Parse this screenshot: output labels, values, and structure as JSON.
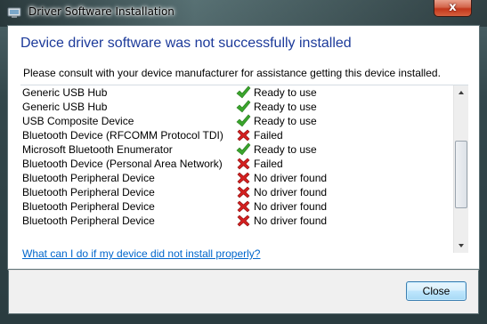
{
  "window": {
    "title": "Driver Software Installation",
    "close_glyph": "x",
    "icon": "usb-device-icon"
  },
  "main": {
    "heading": "Device driver software was not successfully installed",
    "subtext": "Please consult with your device manufacturer for assistance getting this device installed."
  },
  "devices": [
    {
      "name": "Generic USB Hub",
      "status": "Ready to use",
      "icon": "check-icon"
    },
    {
      "name": "Generic USB Hub",
      "status": "Ready to use",
      "icon": "check-icon"
    },
    {
      "name": "USB Composite Device",
      "status": "Ready to use",
      "icon": "check-icon"
    },
    {
      "name": "Bluetooth Device (RFCOMM Protocol TDI)",
      "status": "Failed",
      "icon": "error-x-icon"
    },
    {
      "name": "Microsoft Bluetooth Enumerator",
      "status": "Ready to use",
      "icon": "check-icon"
    },
    {
      "name": "Bluetooth Device (Personal Area Network)",
      "status": "Failed",
      "icon": "error-x-icon"
    },
    {
      "name": "Bluetooth Peripheral Device",
      "status": "No driver found",
      "icon": "error-x-icon"
    },
    {
      "name": "Bluetooth Peripheral Device",
      "status": "No driver found",
      "icon": "error-x-icon"
    },
    {
      "name": "Bluetooth Peripheral Device",
      "status": "No driver found",
      "icon": "error-x-icon"
    },
    {
      "name": "Bluetooth Peripheral Device",
      "status": "No driver found",
      "icon": "error-x-icon"
    }
  ],
  "help_link": "What can I do if my device did not install properly?",
  "footer": {
    "close_label": "Close"
  },
  "colors": {
    "heading": "#1c3a9a",
    "link": "#0066cc",
    "success": "#3aa52c",
    "error": "#d42020"
  }
}
